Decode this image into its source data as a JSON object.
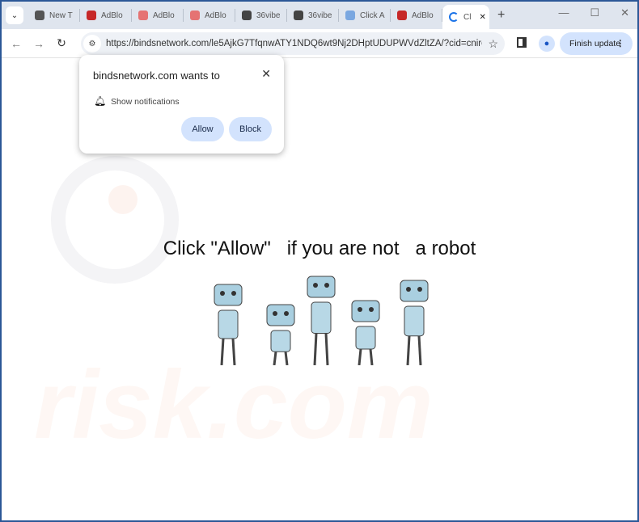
{
  "tabs": [
    {
      "label": "New T",
      "color": "#555"
    },
    {
      "label": "AdBlo",
      "color": "#c62828"
    },
    {
      "label": "AdBlo",
      "color": "#e57373"
    },
    {
      "label": "AdBlo",
      "color": "#e57373"
    },
    {
      "label": "36vibe",
      "color": "#444"
    },
    {
      "label": "36vibe",
      "color": "#444"
    },
    {
      "label": "Click A",
      "color": "#7aa7e0"
    },
    {
      "label": "AdBlo",
      "color": "#c62828"
    }
  ],
  "active_tab": {
    "label": "Cl",
    "close": "✕"
  },
  "toolbar": {
    "url": "https://bindsnetwork.com/le5AjkG7TfqnwATY1NDQ6wt9Nj2DHptUDUPWVdZltZA/?cid=cniroi...",
    "finish_update": "Finish update"
  },
  "popup": {
    "title": "bindsnetwork.com wants to",
    "permission": "Show notifications",
    "allow": "Allow",
    "block": "Block"
  },
  "page": {
    "message": "Click \"Allow\"   if you are not   a robot",
    "watermark": "risk.com"
  }
}
